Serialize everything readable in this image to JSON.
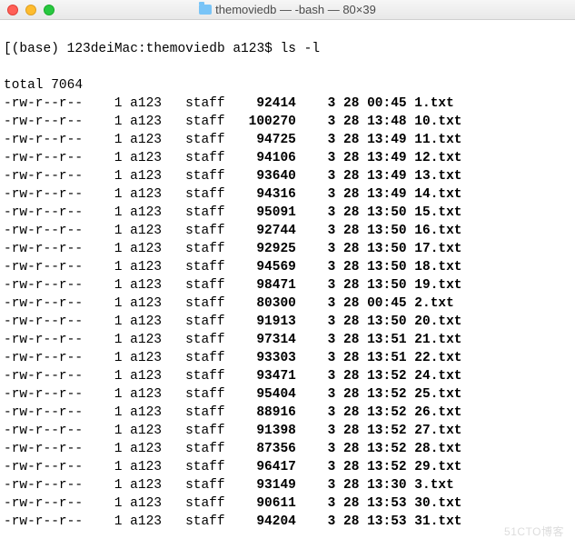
{
  "window": {
    "title": "themoviedb — -bash — 80×39"
  },
  "prompt": {
    "env": "(base)",
    "hostpath": "123deiMac:themoviedb",
    "user": "a123$",
    "command": "ls -l"
  },
  "summary_line": "total 7064",
  "rows": [
    {
      "perm": "-rw-r--r--",
      "links": "1",
      "user": "a123",
      "group": "staff",
      "size": "92414",
      "mon": "3",
      "day": "28",
      "time": "00:45",
      "name": "1.txt"
    },
    {
      "perm": "-rw-r--r--",
      "links": "1",
      "user": "a123",
      "group": "staff",
      "size": "100270",
      "mon": "3",
      "day": "28",
      "time": "13:48",
      "name": "10.txt"
    },
    {
      "perm": "-rw-r--r--",
      "links": "1",
      "user": "a123",
      "group": "staff",
      "size": "94725",
      "mon": "3",
      "day": "28",
      "time": "13:49",
      "name": "11.txt"
    },
    {
      "perm": "-rw-r--r--",
      "links": "1",
      "user": "a123",
      "group": "staff",
      "size": "94106",
      "mon": "3",
      "day": "28",
      "time": "13:49",
      "name": "12.txt"
    },
    {
      "perm": "-rw-r--r--",
      "links": "1",
      "user": "a123",
      "group": "staff",
      "size": "93640",
      "mon": "3",
      "day": "28",
      "time": "13:49",
      "name": "13.txt"
    },
    {
      "perm": "-rw-r--r--",
      "links": "1",
      "user": "a123",
      "group": "staff",
      "size": "94316",
      "mon": "3",
      "day": "28",
      "time": "13:49",
      "name": "14.txt"
    },
    {
      "perm": "-rw-r--r--",
      "links": "1",
      "user": "a123",
      "group": "staff",
      "size": "95091",
      "mon": "3",
      "day": "28",
      "time": "13:50",
      "name": "15.txt"
    },
    {
      "perm": "-rw-r--r--",
      "links": "1",
      "user": "a123",
      "group": "staff",
      "size": "92744",
      "mon": "3",
      "day": "28",
      "time": "13:50",
      "name": "16.txt"
    },
    {
      "perm": "-rw-r--r--",
      "links": "1",
      "user": "a123",
      "group": "staff",
      "size": "92925",
      "mon": "3",
      "day": "28",
      "time": "13:50",
      "name": "17.txt"
    },
    {
      "perm": "-rw-r--r--",
      "links": "1",
      "user": "a123",
      "group": "staff",
      "size": "94569",
      "mon": "3",
      "day": "28",
      "time": "13:50",
      "name": "18.txt"
    },
    {
      "perm": "-rw-r--r--",
      "links": "1",
      "user": "a123",
      "group": "staff",
      "size": "98471",
      "mon": "3",
      "day": "28",
      "time": "13:50",
      "name": "19.txt"
    },
    {
      "perm": "-rw-r--r--",
      "links": "1",
      "user": "a123",
      "group": "staff",
      "size": "80300",
      "mon": "3",
      "day": "28",
      "time": "00:45",
      "name": "2.txt"
    },
    {
      "perm": "-rw-r--r--",
      "links": "1",
      "user": "a123",
      "group": "staff",
      "size": "91913",
      "mon": "3",
      "day": "28",
      "time": "13:50",
      "name": "20.txt"
    },
    {
      "perm": "-rw-r--r--",
      "links": "1",
      "user": "a123",
      "group": "staff",
      "size": "97314",
      "mon": "3",
      "day": "28",
      "time": "13:51",
      "name": "21.txt"
    },
    {
      "perm": "-rw-r--r--",
      "links": "1",
      "user": "a123",
      "group": "staff",
      "size": "93303",
      "mon": "3",
      "day": "28",
      "time": "13:51",
      "name": "22.txt"
    },
    {
      "perm": "-rw-r--r--",
      "links": "1",
      "user": "a123",
      "group": "staff",
      "size": "93471",
      "mon": "3",
      "day": "28",
      "time": "13:52",
      "name": "24.txt"
    },
    {
      "perm": "-rw-r--r--",
      "links": "1",
      "user": "a123",
      "group": "staff",
      "size": "95404",
      "mon": "3",
      "day": "28",
      "time": "13:52",
      "name": "25.txt"
    },
    {
      "perm": "-rw-r--r--",
      "links": "1",
      "user": "a123",
      "group": "staff",
      "size": "88916",
      "mon": "3",
      "day": "28",
      "time": "13:52",
      "name": "26.txt"
    },
    {
      "perm": "-rw-r--r--",
      "links": "1",
      "user": "a123",
      "group": "staff",
      "size": "91398",
      "mon": "3",
      "day": "28",
      "time": "13:52",
      "name": "27.txt"
    },
    {
      "perm": "-rw-r--r--",
      "links": "1",
      "user": "a123",
      "group": "staff",
      "size": "87356",
      "mon": "3",
      "day": "28",
      "time": "13:52",
      "name": "28.txt"
    },
    {
      "perm": "-rw-r--r--",
      "links": "1",
      "user": "a123",
      "group": "staff",
      "size": "96417",
      "mon": "3",
      "day": "28",
      "time": "13:52",
      "name": "29.txt"
    },
    {
      "perm": "-rw-r--r--",
      "links": "1",
      "user": "a123",
      "group": "staff",
      "size": "93149",
      "mon": "3",
      "day": "28",
      "time": "13:30",
      "name": "3.txt"
    },
    {
      "perm": "-rw-r--r--",
      "links": "1",
      "user": "a123",
      "group": "staff",
      "size": "90611",
      "mon": "3",
      "day": "28",
      "time": "13:53",
      "name": "30.txt"
    },
    {
      "perm": "-rw-r--r--",
      "links": "1",
      "user": "a123",
      "group": "staff",
      "size": "94204",
      "mon": "3",
      "day": "28",
      "time": "13:53",
      "name": "31.txt"
    }
  ],
  "watermark": "51CTO博客"
}
